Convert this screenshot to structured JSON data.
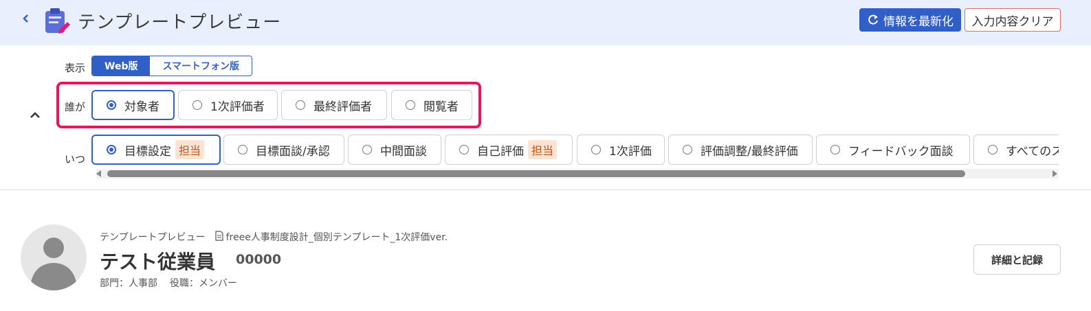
{
  "header": {
    "back_icon": "chevron-left-icon",
    "title_icon": "clipboard-edit-icon",
    "title": "テンプレートプレビュー",
    "refresh_label": "情報を最新化",
    "clear_label": "入力内容クリア",
    "accent_color": "#2f5fc7"
  },
  "controls": {
    "collapse_icon": "chevron-up-icon",
    "display": {
      "label": "表示",
      "options": [
        "Web版",
        "スマートフォン版"
      ],
      "selected": "Web版"
    },
    "who": {
      "label": "誰が",
      "options": [
        "対象者",
        "1次評価者",
        "最終評価者",
        "閲覧者"
      ],
      "selected": "対象者",
      "highlight_color": "#e8175d"
    },
    "when": {
      "label": "いつ",
      "options": [
        {
          "label": "目標設定",
          "tag": "担当"
        },
        {
          "label": "目標面談/承認",
          "tag": ""
        },
        {
          "label": "中間面談",
          "tag": ""
        },
        {
          "label": "自己評価",
          "tag": "担当"
        },
        {
          "label": "1次評価",
          "tag": ""
        },
        {
          "label": "評価調整/最終評価",
          "tag": ""
        },
        {
          "label": "フィードバック面談",
          "tag": ""
        },
        {
          "label": "すべてのス",
          "tag": ""
        }
      ],
      "selected": "目標設定"
    }
  },
  "employee": {
    "breadcrumb_root": "テンプレートプレビュー",
    "template_name": "freee人事制度設計_個別テンプレート_1次評価ver.",
    "name": "テスト従業員",
    "id": "00000",
    "department": "部門：人事部",
    "position": "役職：メンバー",
    "detail_button": "詳細と記録"
  }
}
